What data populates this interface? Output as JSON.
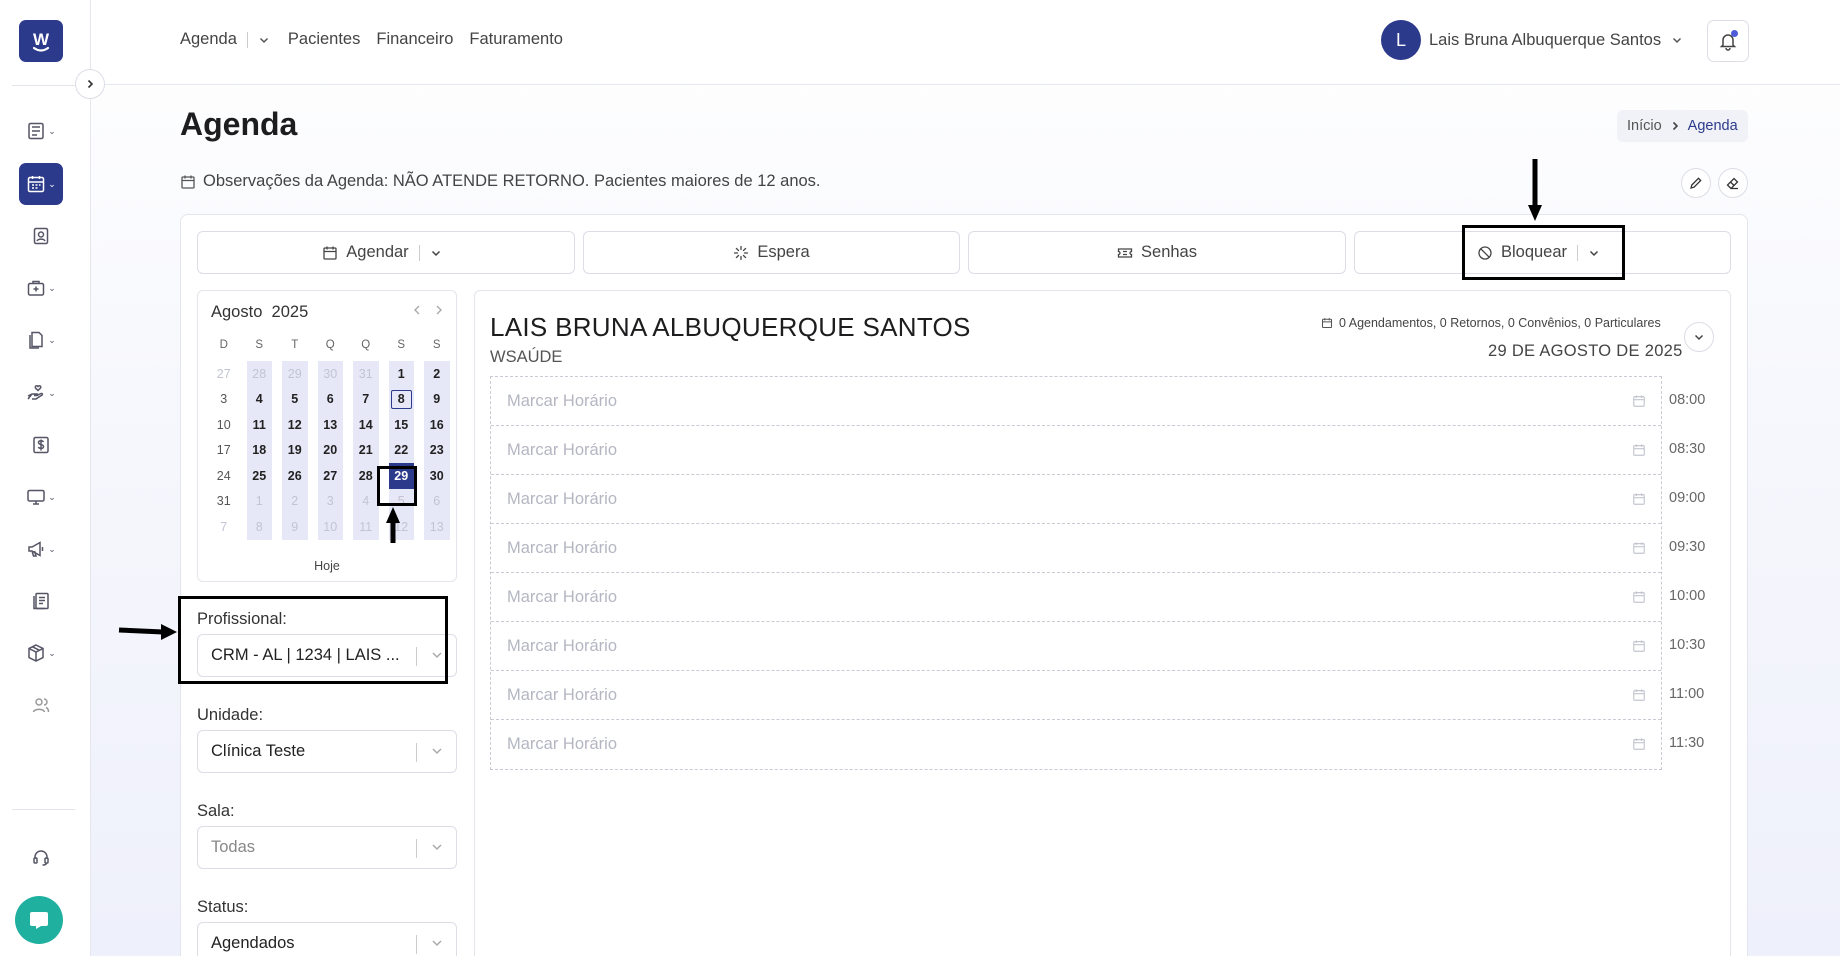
{
  "nav": {
    "links": [
      "Agenda",
      "Pacientes",
      "Financeiro",
      "Faturamento"
    ],
    "user_name": "Lais Bruna Albuquerque Santos",
    "user_initial": "L"
  },
  "sidebar": {
    "logo_letter": "W",
    "items": [
      {
        "icon": "list-icon",
        "active": false
      },
      {
        "icon": "calendar-icon",
        "active": true
      },
      {
        "icon": "patient-id-icon",
        "active": false
      },
      {
        "icon": "medical-kit-icon",
        "active": false
      },
      {
        "icon": "documents-icon",
        "active": false
      },
      {
        "icon": "hand-heart-icon",
        "active": false
      },
      {
        "icon": "dollar-icon",
        "active": false
      },
      {
        "icon": "monitor-icon",
        "active": false
      },
      {
        "icon": "megaphone-icon",
        "active": false
      },
      {
        "icon": "reports-icon",
        "active": false
      },
      {
        "icon": "package-icon",
        "active": false
      },
      {
        "icon": "users-icon",
        "active": false
      },
      {
        "icon": "headset-icon",
        "active": false
      }
    ]
  },
  "page": {
    "title": "Agenda",
    "breadcrumb": {
      "home": "Início",
      "current": "Agenda"
    },
    "observation": "Observações da Agenda: NÃO ATENDE RETORNO. Pacientes maiores de 12 anos."
  },
  "actions": {
    "agendar": "Agendar",
    "espera": "Espera",
    "senhas": "Senhas",
    "bloquear": "Bloquear"
  },
  "calendar": {
    "month": "Agosto",
    "year": "2025",
    "weekdays": [
      "D",
      "S",
      "T",
      "Q",
      "Q",
      "S",
      "S"
    ],
    "weeks": [
      [
        {
          "d": "27",
          "m": true
        },
        {
          "d": "28",
          "m": true
        },
        {
          "d": "29",
          "m": true
        },
        {
          "d": "30",
          "m": true
        },
        {
          "d": "31",
          "m": true
        },
        {
          "d": "1"
        },
        {
          "d": "2"
        }
      ],
      [
        {
          "d": "3"
        },
        {
          "d": "4"
        },
        {
          "d": "5"
        },
        {
          "d": "6"
        },
        {
          "d": "7"
        },
        {
          "d": "8",
          "today": true
        },
        {
          "d": "9"
        }
      ],
      [
        {
          "d": "10"
        },
        {
          "d": "11"
        },
        {
          "d": "12"
        },
        {
          "d": "13"
        },
        {
          "d": "14"
        },
        {
          "d": "15"
        },
        {
          "d": "16"
        }
      ],
      [
        {
          "d": "17"
        },
        {
          "d": "18"
        },
        {
          "d": "19"
        },
        {
          "d": "20"
        },
        {
          "d": "21"
        },
        {
          "d": "22"
        },
        {
          "d": "23"
        }
      ],
      [
        {
          "d": "24"
        },
        {
          "d": "25"
        },
        {
          "d": "26"
        },
        {
          "d": "27"
        },
        {
          "d": "28"
        },
        {
          "d": "29",
          "selected": true
        },
        {
          "d": "30"
        }
      ],
      [
        {
          "d": "31"
        },
        {
          "d": "1",
          "m": true
        },
        {
          "d": "2",
          "m": true
        },
        {
          "d": "3",
          "m": true
        },
        {
          "d": "4",
          "m": true
        },
        {
          "d": "5",
          "m": true
        },
        {
          "d": "6",
          "m": true
        }
      ],
      [
        {
          "d": "7",
          "m": true
        },
        {
          "d": "8",
          "m": true
        },
        {
          "d": "9",
          "m": true
        },
        {
          "d": "10",
          "m": true
        },
        {
          "d": "11",
          "m": true
        },
        {
          "d": "12",
          "m": true
        },
        {
          "d": "13",
          "m": true
        }
      ]
    ],
    "today_label": "Hoje"
  },
  "filters": {
    "profissional": {
      "label": "Profissional:",
      "value": "CRM - AL | 1234 | LAIS ..."
    },
    "unidade": {
      "label": "Unidade:",
      "value": "Clínica Teste"
    },
    "sala": {
      "label": "Sala:",
      "value": "Todas"
    },
    "status": {
      "label": "Status:",
      "value": "Agendados"
    }
  },
  "schedule": {
    "professional": "LAIS BRUNA ALBUQUERQUE SANTOS",
    "clinic": "WSAÚDE",
    "stats": "0 Agendamentos, 0 Retornos, 0 Convênios, 0 Particulares",
    "date": "29 DE AGOSTO DE 2025",
    "slot_label": "Marcar Horário",
    "times": [
      "08:00",
      "08:30",
      "09:00",
      "09:30",
      "10:00",
      "10:30",
      "11:00",
      "11:30"
    ]
  },
  "colors": {
    "brand": "#2c3a8c",
    "chat": "#1fb0a0",
    "work_day_bg": "#e6e8f7"
  }
}
